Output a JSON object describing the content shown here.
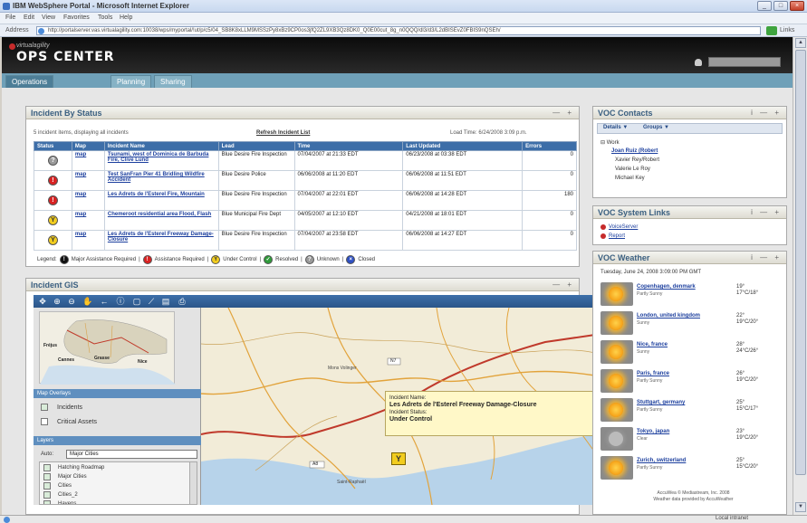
{
  "browser": {
    "title": "IBM WebSphere Portal - Microsoft Internet Explorer",
    "menu": [
      "File",
      "Edit",
      "View",
      "Favorites",
      "Tools",
      "Help"
    ],
    "address_label": "Address",
    "url": "http://portalserver.vas.virtualagility.com:10038/wps/myportal/!ut/p/c5/04_SB8K8xLLM9MSSzPy8xBz9CP0os3jfQ2ZL9XB3Qz8DK0_Q0E00cut_8g_n0QQQ/dl3/d3/L2dBISEvZ0FBIS9nQSEh/",
    "go_label": "Go",
    "links_label": "Links",
    "status_text": "Local intranet"
  },
  "portal": {
    "logo_top": "virtualagility",
    "logo_main": "OPS CENTER",
    "tabs": [
      "Operations",
      "Planning",
      "Sharing"
    ]
  },
  "incident_status": {
    "title": "Incident By Status",
    "controls": "— +",
    "summary": "5 incident items, displaying all incidents",
    "refresh": "Refresh Incident List",
    "load_time": "Load Time: 6/24/2008 3:09 p.m.",
    "columns": [
      "Status",
      "Map",
      "Incident Name",
      "Lead",
      "Time",
      "Last Updated",
      "Errors"
    ],
    "rows": [
      {
        "status": "grey",
        "map": "map",
        "name": "Tsunami, west of Dominica de Barbuda Fire, Clive Lund",
        "lead": "Blue Desire Fire Inspection",
        "time": "07/04/2007 at 21:33 EDT",
        "updated": "06/23/2008 at 03:38 EDT",
        "errors": "0"
      },
      {
        "status": "red",
        "map": "map",
        "name": "Test SanFran Pier 41 Bridling Wildfire Accident",
        "lead": "Blue Desire Police",
        "time": "06/06/2008 at 11:20 EDT",
        "updated": "06/06/2008 at 11:51 EDT",
        "errors": "0"
      },
      {
        "status": "red",
        "map": "map",
        "name": "Les Adrets de l'Esterel Fire, Mountain",
        "lead": "Blue Desire Fire Inspection",
        "time": "07/04/2007 at 22:01 EDT",
        "updated": "06/06/2008 at 14:28 EDT",
        "errors": "180"
      },
      {
        "status": "yellow",
        "map": "map",
        "name": "Chemeroot residential area Flood, Flash",
        "lead": "Blue Municipal Fire Dept",
        "time": "04/05/2007 at 12:10 EDT",
        "updated": "04/21/2008 at 18:01 EDT",
        "errors": "0"
      },
      {
        "status": "yellow",
        "map": "map",
        "name": "Les Adrets de l'Esterel Freeway Damage-Closure",
        "lead": "Blue Desire Fire Inspection",
        "time": "07/04/2007 at 23:58 EDT",
        "updated": "06/06/2008 at 14:27 EDT",
        "errors": "0"
      }
    ],
    "legend_label": "Legend:",
    "legend": [
      {
        "color": "black",
        "label": "Major Assistance Required"
      },
      {
        "color": "red",
        "label": "Assistance Required"
      },
      {
        "color": "yellow",
        "label": "Under Control"
      },
      {
        "color": "green",
        "label": "Resolved"
      },
      {
        "color": "grey",
        "label": "Unknown"
      },
      {
        "color": "blue",
        "label": "Closed"
      }
    ]
  },
  "gis": {
    "title": "Incident GIS",
    "controls": "— +",
    "overview_labels": [
      "Fréjus",
      "Cannes",
      "Grasse",
      "Nice"
    ],
    "overlays_header": "Map Overlays",
    "overlays": [
      {
        "label": "Incidents",
        "checked": true
      },
      {
        "label": "Critical Assets",
        "checked": false
      }
    ],
    "layers_header": "Layers",
    "auto_label": "Auto:",
    "auto_value": "Major Cities",
    "layers": [
      "Hatching Roadmap",
      "Major Cities",
      "Cities",
      "Cities_2",
      "Havens"
    ],
    "popup": {
      "name_label": "Incident Name:",
      "name": "Les Adrets de l'Esterel Freeway Damage-Closure",
      "status_label": "Incident Status:",
      "status": "Under Control"
    },
    "marker_label": "Y",
    "map_labels": [
      "Mons Volinger",
      "Saint-Raphaël"
    ],
    "road_labels": [
      "A8",
      "N7"
    ]
  },
  "contacts": {
    "title": "VOC Contacts",
    "controls": "i — +",
    "tabs": [
      "Details ▼",
      "Groups ▼"
    ],
    "tree": [
      "Work",
      "Joan Ruiz (Robert",
      "Xavier Rey/Robert",
      "Valerie Le Roy",
      "Michael Key"
    ]
  },
  "system_links": {
    "title": "VOC System Links",
    "controls": "i — +",
    "links": [
      "VoiceServer",
      "Report"
    ]
  },
  "weather": {
    "title": "VOC Weather",
    "controls": "i — +",
    "date": "Tuesday, June 24, 2008 3:09:00 PM GMT",
    "cities": [
      {
        "city": "Copenhagen, denmark",
        "cond": "Partly Sunny",
        "temp": "19°",
        "unit": "17°C/18°",
        "cloudy": false
      },
      {
        "city": "London, united kingdom",
        "cond": "Sunny",
        "temp": "22°",
        "unit": "19°C/20°",
        "cloudy": false
      },
      {
        "city": "Nice, france",
        "cond": "Sunny",
        "temp": "28°",
        "unit": "24°C/26°",
        "cloudy": false
      },
      {
        "city": "Paris, france",
        "cond": "Partly Sunny",
        "temp": "26°",
        "unit": "19°C/20°",
        "cloudy": false
      },
      {
        "city": "Stuttgart, germany",
        "cond": "Partly Sunny",
        "temp": "25°",
        "unit": "15°C/17°",
        "cloudy": false
      },
      {
        "city": "Tokyo, japan",
        "cond": "Clear",
        "temp": "23°",
        "unit": "19°C/20°",
        "cloudy": true
      },
      {
        "city": "Zurich, switzerland",
        "cond": "Partly Sunny",
        "temp": "25°",
        "unit": "15°C/20°",
        "cloudy": false
      }
    ],
    "footer_1": "AccuWea © Mediastream, Inc. 2008",
    "footer_2": "Weather data provided by AccuWeather"
  }
}
